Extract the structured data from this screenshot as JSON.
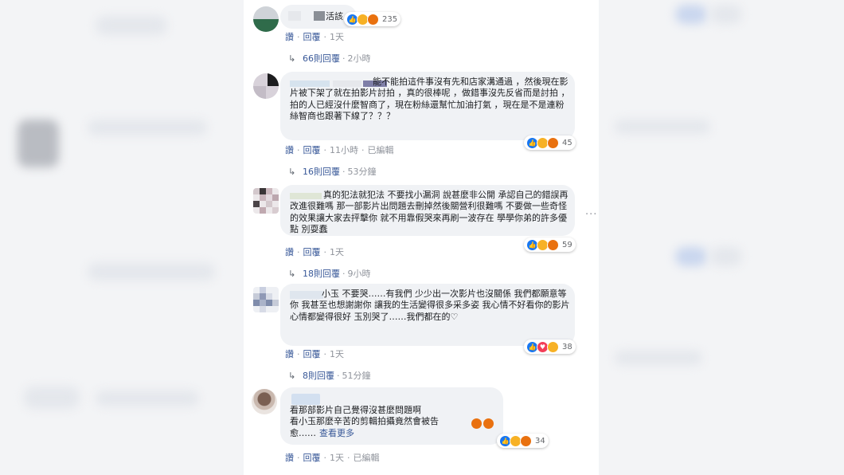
{
  "comments": [
    {
      "text": "活該",
      "reactions": {
        "icons": [
          "like-icon",
          "haha-icon",
          "angry-icon"
        ],
        "count": "235"
      },
      "actions": {
        "like": "讚",
        "reply": "回覆",
        "time": "1天",
        "edited": ""
      },
      "replies": {
        "label": "66則回覆",
        "time": "2小時"
      }
    },
    {
      "text": "能不能拍這件事沒有先和店家溝通過 ，然後現在影片被下架了就在拍影片討拍 ，真的很棒呢 ，做錯事沒先反省而是討拍 ，拍的人已經沒什麼智商了，現在粉絲還幫忙加油打氣 ，現在是不是連粉絲智商也跟著下線了？？？",
      "reactions": {
        "icons": [
          "like-icon",
          "haha-icon",
          "angry-icon"
        ],
        "count": "45"
      },
      "actions": {
        "like": "讚",
        "reply": "回覆",
        "time": "11小時",
        "edited": "已編輯"
      },
      "replies": {
        "label": "16則回覆",
        "time": "53分鐘"
      }
    },
    {
      "text": "真的犯法就犯法 不要找小漏洞 說甚麼非公開 承認自己的錯誤再改進很難嗎 那一部影片出問題去刪掉然後關營利很難嗎 不要做一些奇怪的效果讓大家去抨擊你 就不用靠假哭來再刷一波存在 學學你弟的許多優點 別耍蠢",
      "reactions": {
        "icons": [
          "like-icon",
          "haha-icon",
          "angry-icon"
        ],
        "count": "59"
      },
      "actions": {
        "like": "讚",
        "reply": "回覆",
        "time": "1天",
        "edited": ""
      },
      "replies": {
        "label": "18則回覆",
        "time": "9小時"
      }
    },
    {
      "text": "小玉 不要哭……有我們 少少出一次影片也沒關係 我們都願意等你 我甚至也想謝謝你 讓我的生活變得很多采多姿 我心情不好看你的影片心情都變得很好 玉別哭了……我們都在的♡",
      "reactions": {
        "icons": [
          "like-icon",
          "love-icon",
          "haha-icon"
        ],
        "count": "38"
      },
      "actions": {
        "like": "讚",
        "reply": "回覆",
        "time": "1天",
        "edited": ""
      },
      "replies": {
        "label": "8則回覆",
        "time": "51分鐘"
      }
    },
    {
      "text": "看那部影片自己覺得沒甚麼問題啊\n看小玉那麼辛苦的剪輯拍攝竟然會被告",
      "text_tail": "愈……",
      "see_more": "查看更多",
      "reactions": {
        "icons": [
          "like-icon",
          "haha-icon",
          "angry-icon"
        ],
        "count": "34"
      },
      "actions": {
        "like": "讚",
        "reply": "回覆",
        "time": "1天",
        "edited": "已編輯"
      }
    }
  ],
  "menu_icon": "more-dots-icon",
  "colors": {
    "link": "#385898",
    "meta": "#90949c",
    "bubble": "#f0f2f5",
    "like": "#1877f2"
  }
}
